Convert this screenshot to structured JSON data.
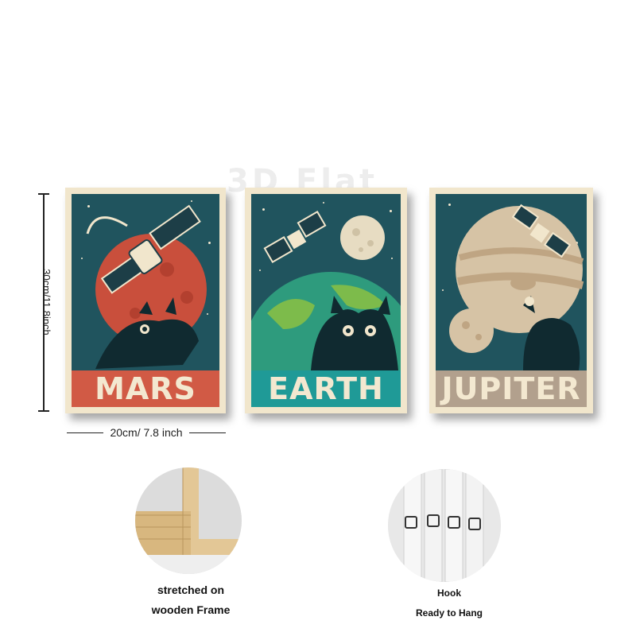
{
  "watermark": "3D Flat",
  "dimensions": {
    "height_label": "30cm/11.8inch",
    "width_label": "20cm/ 7.8 inch"
  },
  "posters": [
    {
      "label": "MARS",
      "banner_color": "#d15a45",
      "planet_color": "#c94f3c"
    },
    {
      "label": "EARTH",
      "banner_color": "#1f9a97",
      "planet_color": "#2e9b7d"
    },
    {
      "label": "JUPITER",
      "banner_color": "#b2a08d",
      "planet_color": "#d6c3a5"
    }
  ],
  "features": [
    {
      "icon": "wooden-frame-corner",
      "caption_line1": "stretched on",
      "caption_line2": "wooden Frame"
    },
    {
      "icon": "hook-hardware",
      "caption_line1": "Hook",
      "caption_line2": "Ready to Hang"
    }
  ]
}
